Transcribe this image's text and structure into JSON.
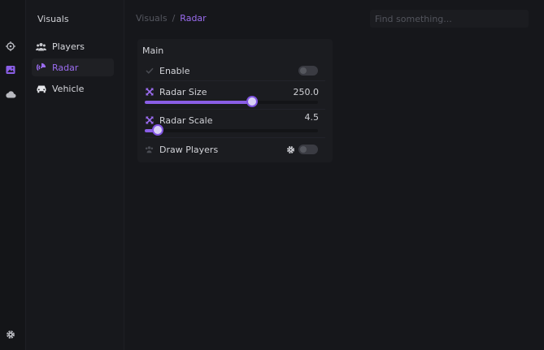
{
  "sidebar": {
    "title": "Visuals",
    "items": [
      {
        "label": "Players",
        "icon": "users-icon"
      },
      {
        "label": "Radar",
        "icon": "radar-icon",
        "active": true
      },
      {
        "label": "Vehicle",
        "icon": "car-icon"
      }
    ]
  },
  "breadcrumb": {
    "parent": "Visuals",
    "separator": "/",
    "current": "Radar"
  },
  "search": {
    "placeholder": "Find something..."
  },
  "panel": {
    "title": "Main",
    "enable": {
      "label": "Enable",
      "checked": false
    },
    "radar_size": {
      "label": "Radar Size",
      "value": "250.0",
      "fraction": 0.62
    },
    "radar_scale": {
      "label": "Radar Scale",
      "value": "4.5",
      "fraction": 0.075
    },
    "draw_players": {
      "label": "Draw Players",
      "checked": false
    }
  },
  "colors": {
    "accent": "#9b6cf0",
    "background": "#16171b",
    "panel": "#1b1c20"
  }
}
